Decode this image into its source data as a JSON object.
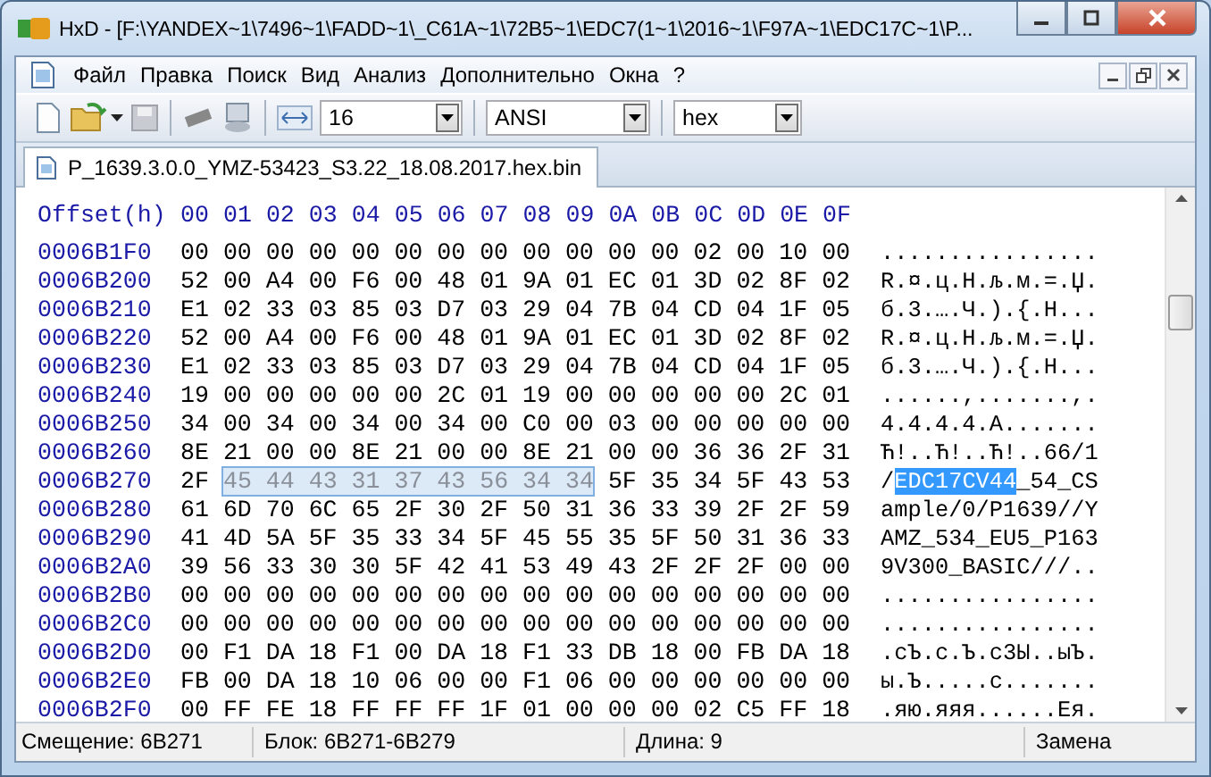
{
  "window": {
    "title": "HxD - [F:\\YANDEX~1\\7496~1\\FADD~1\\_C61A~1\\72B5~1\\EDC7(1~1\\2016~1\\F97A~1\\EDC17C~1\\P..."
  },
  "menu": [
    "Файл",
    "Правка",
    "Поиск",
    "Вид",
    "Анализ",
    "Дополнительно",
    "Окна",
    "?"
  ],
  "toolbar": {
    "bytes_per_row": "16",
    "charset": "ANSI",
    "offset_base": "hex"
  },
  "tabs": [
    {
      "label": "P_1639.3.0.0_YMZ-53423_S3.22_18.08.2017.hex.bin",
      "selected": true
    }
  ],
  "hex_view": {
    "header": {
      "offset": "Offset(h)",
      "columns": [
        "00",
        "01",
        "02",
        "03",
        "04",
        "05",
        "06",
        "07",
        "08",
        "09",
        "0A",
        "0B",
        "0C",
        "0D",
        "0E",
        "0F"
      ]
    },
    "rows": [
      {
        "offset": "0006B1F0",
        "hex": [
          {
            "text": "00 00 00 00 00 00 00 00 00 00 00 00 02 00 10 00",
            "selected": false
          }
        ],
        "text": [
          {
            "text": "................",
            "selected": false
          }
        ]
      },
      {
        "offset": "0006B200",
        "hex": [
          {
            "text": "52 00 A4 00 F6 00 48 01 9A 01 EC 01 3D 02 8F 02",
            "selected": false
          }
        ],
        "text": [
          {
            "text": "R.¤.ц.H.љ.м.=.Џ.",
            "selected": false
          }
        ]
      },
      {
        "offset": "0006B210",
        "hex": [
          {
            "text": "E1 02 33 03 85 03 D7 03 29 04 7B 04 CD 04 1F 05",
            "selected": false
          }
        ],
        "text": [
          {
            "text": "б.3.….Ч.).{.Н...",
            "selected": false
          }
        ]
      },
      {
        "offset": "0006B220",
        "hex": [
          {
            "text": "52 00 A4 00 F6 00 48 01 9A 01 EC 01 3D 02 8F 02",
            "selected": false
          }
        ],
        "text": [
          {
            "text": "R.¤.ц.H.љ.м.=.Џ.",
            "selected": false
          }
        ]
      },
      {
        "offset": "0006B230",
        "hex": [
          {
            "text": "E1 02 33 03 85 03 D7 03 29 04 7B 04 CD 04 1F 05",
            "selected": false
          }
        ],
        "text": [
          {
            "text": "б.3.….Ч.).{.Н...",
            "selected": false
          }
        ]
      },
      {
        "offset": "0006B240",
        "hex": [
          {
            "text": "19 00 00 00 00 00 2C 01 19 00 00 00 00 00 2C 01",
            "selected": false
          }
        ],
        "text": [
          {
            "text": "......,.......,.",
            "selected": false
          }
        ]
      },
      {
        "offset": "0006B250",
        "hex": [
          {
            "text": "34 00 34 00 34 00 34 00 C0 00 03 00 00 00 00 00",
            "selected": false
          }
        ],
        "text": [
          {
            "text": "4.4.4.4.А.......",
            "selected": false
          }
        ]
      },
      {
        "offset": "0006B260",
        "hex": [
          {
            "text": "8E 21 00 00 8E 21 00 00 8E 21 00 00 36 36 2F 31",
            "selected": false
          }
        ],
        "text": [
          {
            "text": "Ћ!..Ћ!..Ћ!..66/1",
            "selected": false
          }
        ]
      },
      {
        "offset": "0006B270",
        "hex": [
          {
            "text": "2F",
            "selected": false
          },
          {
            "text": "45 44 43 31 37 43 56 34 34",
            "selected": true
          },
          {
            "text": "5F 35 34 5F 43 53",
            "selected": false
          }
        ],
        "text": [
          {
            "text": "/",
            "selected": false
          },
          {
            "text": "EDC17CV44",
            "selected": true
          },
          {
            "text": "_54_CS",
            "selected": false
          }
        ]
      },
      {
        "offset": "0006B280",
        "hex": [
          {
            "text": "61 6D 70 6C 65 2F 30 2F 50 31 36 33 39 2F 2F 59",
            "selected": false
          }
        ],
        "text": [
          {
            "text": "ample/0/P1639//Y",
            "selected": false
          }
        ]
      },
      {
        "offset": "0006B290",
        "hex": [
          {
            "text": "41 4D 5A 5F 35 33 34 5F 45 55 35 5F 50 31 36 33",
            "selected": false
          }
        ],
        "text": [
          {
            "text": "AMZ_534_EU5_P163",
            "selected": false
          }
        ]
      },
      {
        "offset": "0006B2A0",
        "hex": [
          {
            "text": "39 56 33 30 30 5F 42 41 53 49 43 2F 2F 2F 00 00",
            "selected": false
          }
        ],
        "text": [
          {
            "text": "9V300_BASIC///..",
            "selected": false
          }
        ]
      },
      {
        "offset": "0006B2B0",
        "hex": [
          {
            "text": "00 00 00 00 00 00 00 00 00 00 00 00 00 00 00 00",
            "selected": false
          }
        ],
        "text": [
          {
            "text": "................",
            "selected": false
          }
        ]
      },
      {
        "offset": "0006B2C0",
        "hex": [
          {
            "text": "00 00 00 00 00 00 00 00 00 00 00 00 00 00 00 00",
            "selected": false
          }
        ],
        "text": [
          {
            "text": "................",
            "selected": false
          }
        ]
      },
      {
        "offset": "0006B2D0",
        "hex": [
          {
            "text": "00 F1 DA 18 F1 00 DA 18 F1 33 DB 18 00 FB DA 18",
            "selected": false
          }
        ],
        "text": [
          {
            "text": ".сЪ.с.Ъ.с3Ы..ыЪ.",
            "selected": false
          }
        ]
      },
      {
        "offset": "0006B2E0",
        "hex": [
          {
            "text": "FB 00 DA 18 10 06 00 00 F1 06 00 00 00 00 00 00",
            "selected": false
          }
        ],
        "text": [
          {
            "text": "ы.Ъ.....с.......",
            "selected": false
          }
        ]
      },
      {
        "offset": "0006B2F0",
        "hex": [
          {
            "text": "00 FF FE 18 FF FF FF 1F 01 00 00 00 02 C5 FF 18",
            "selected": false
          }
        ],
        "text": [
          {
            "text": ".яю.яяя......Ея.",
            "selected": false
          }
        ]
      }
    ]
  },
  "status_bar": [
    "Смещение: 6B271",
    "Блок: 6B271-6B279",
    "Длина: 9",
    "Замена"
  ]
}
